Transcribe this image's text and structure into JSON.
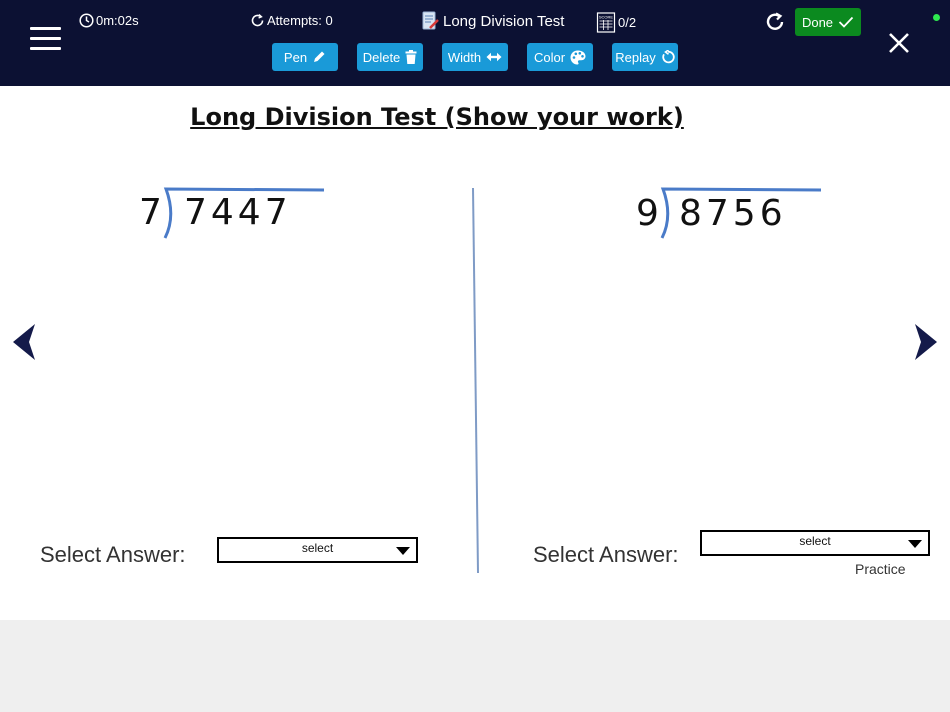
{
  "header": {
    "timer": "0m:02s",
    "attempts": "Attempts: 0",
    "title": "Long Division Test",
    "score": "0/2",
    "done_label": "Done",
    "status_color": "#2ee84f"
  },
  "toolbar": {
    "pen": "Pen",
    "delete": "Delete",
    "width": "Width",
    "color": "Color",
    "replay": "Replay"
  },
  "sheet": {
    "title": "Long Division Test (Show your work)",
    "problems": [
      {
        "divisor": "7",
        "dividend": "7447",
        "select_label": "Select Answer:",
        "select_value": "select"
      },
      {
        "divisor": "9",
        "dividend": "8756",
        "select_label": "Select Answer:",
        "select_value": "select"
      }
    ],
    "practice_label": "Practice"
  },
  "colors": {
    "header_bg": "#0c1133",
    "tool_button": "#1a9ad8",
    "done_button": "#0b8a1f",
    "ink_blue": "#4a7bc8",
    "nav_arrow": "#141a4a"
  }
}
